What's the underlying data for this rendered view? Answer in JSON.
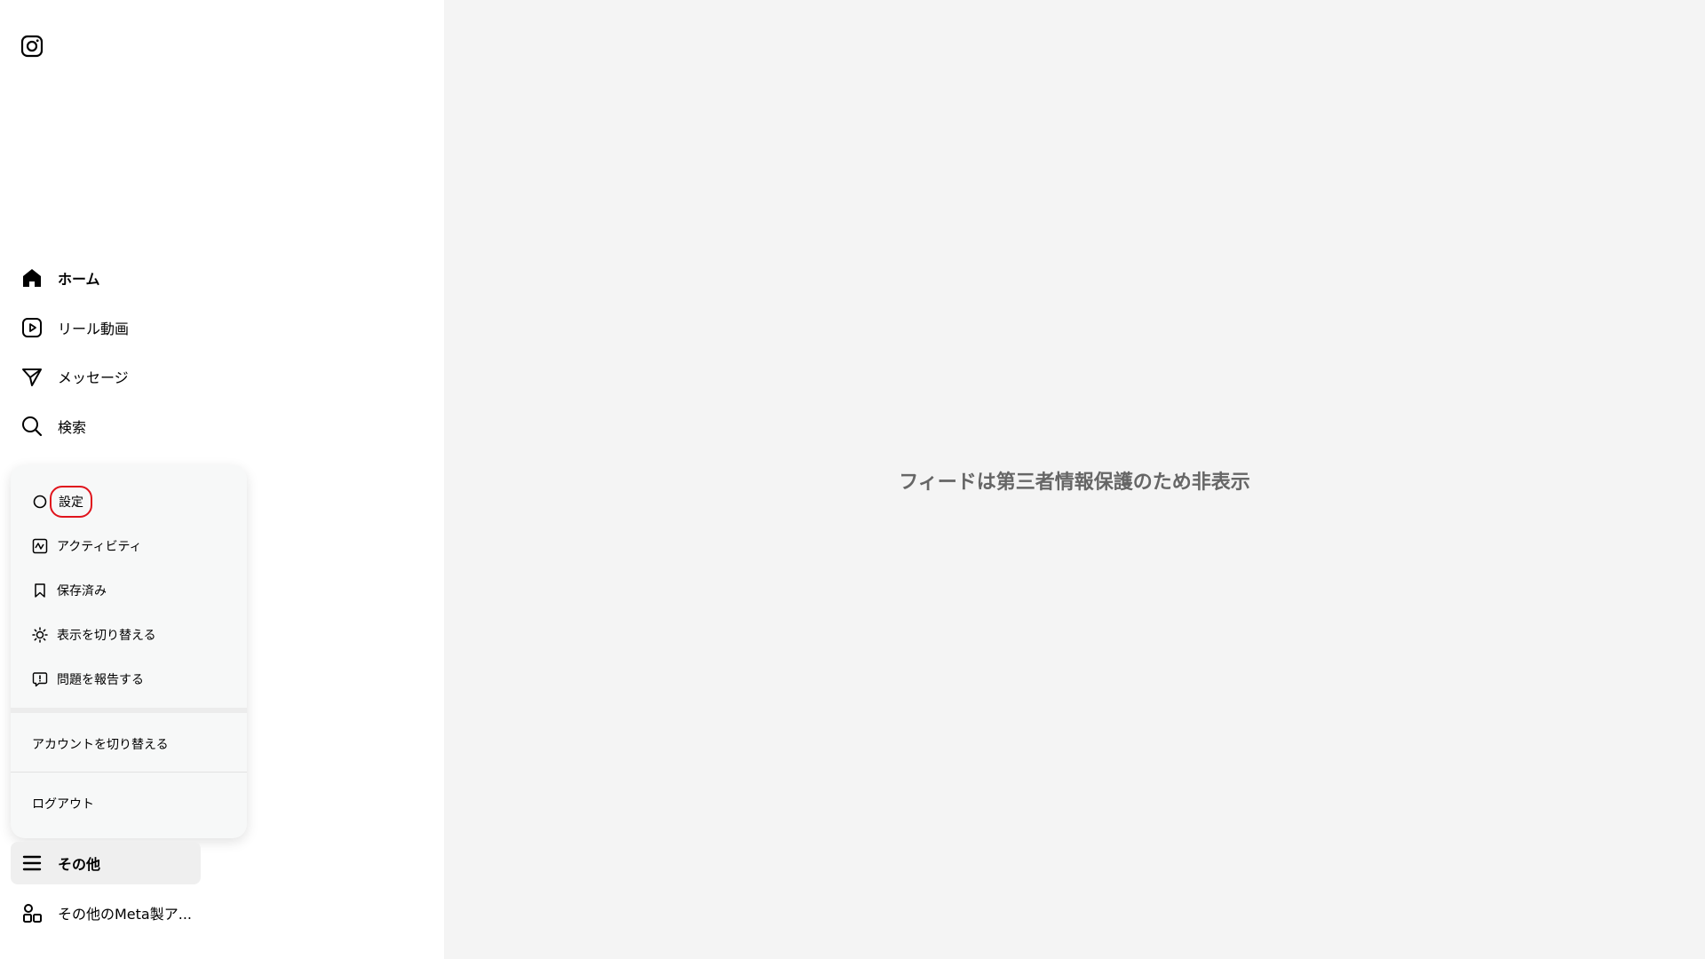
{
  "sidebar": {
    "logo_icon": "instagram-icon",
    "nav": [
      {
        "label": "ホーム",
        "icon": "home-icon"
      },
      {
        "label": "リール動画",
        "icon": "reels-icon"
      },
      {
        "label": "メッセージ",
        "icon": "messages-icon"
      },
      {
        "label": "検索",
        "icon": "search-icon"
      }
    ],
    "more": {
      "label": "その他",
      "icon": "menu-icon"
    },
    "meta_apps": {
      "label": "その他のMeta製ア...",
      "icon": "apps-icon"
    }
  },
  "menu": {
    "items": [
      {
        "label": "設定",
        "icon": "settings-icon"
      },
      {
        "label": "アクティビティ",
        "icon": "activity-icon"
      },
      {
        "label": "保存済み",
        "icon": "bookmark-icon"
      },
      {
        "label": "表示を切り替える",
        "icon": "sun-icon"
      },
      {
        "label": "問題を報告する",
        "icon": "report-icon"
      }
    ],
    "switch_account": "アカウントを切り替える",
    "logout": "ログアウト",
    "highlight_color": "#e0141c"
  },
  "main": {
    "feed_notice": "フィードは第三者情報保護のため非表示"
  }
}
